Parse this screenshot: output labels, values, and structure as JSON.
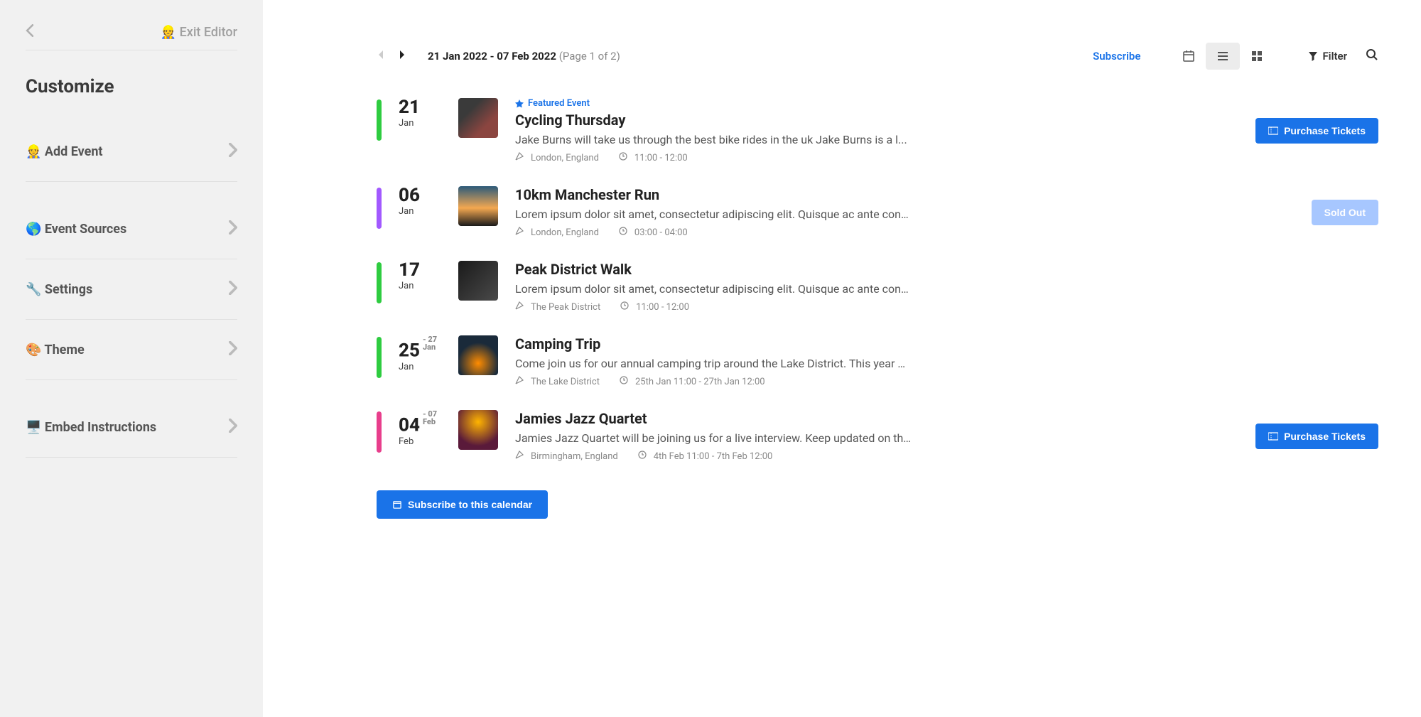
{
  "sidebar": {
    "exit_label": "👷 Exit Editor",
    "heading": "Customize",
    "items": [
      {
        "label": "👷 Add Event"
      },
      {
        "label": "🌎 Event Sources"
      },
      {
        "label": "🔧 Settings"
      },
      {
        "label": "🎨 Theme"
      },
      {
        "label": "🖥️ Embed Instructions"
      }
    ]
  },
  "toolbar": {
    "date_start": "21 Jan 2022",
    "date_end": "07 Feb 2022",
    "page_info": "(Page 1 of 2)",
    "subscribe_label": "Subscribe",
    "filter_label": "Filter"
  },
  "colors": {
    "green": "#2ecc40",
    "purple": "#a259ff",
    "pink": "#e83e8c",
    "primary": "#1a73e8",
    "soldout": "#a7c7ff"
  },
  "actions": {
    "purchase": "Purchase Tickets",
    "soldout": "Sold Out",
    "subscribe_bottom": "Subscribe to this calendar"
  },
  "events": [
    {
      "day": "21",
      "month": "Jan",
      "end_day": "",
      "end_month": "",
      "color": "green",
      "featured": true,
      "featured_label": "Featured Event",
      "title": "Cycling Thursday",
      "desc": "Jake Burns will take us through the best bike rides in the uk Jake Burns is a l...",
      "location": "London, England",
      "time": "11:00 - 12:00",
      "action": "purchase",
      "thumb": "cycling"
    },
    {
      "day": "06",
      "month": "Jan",
      "end_day": "",
      "end_month": "",
      "color": "purple",
      "featured": false,
      "title": "10km Manchester Run",
      "desc": "Lorem ipsum dolor sit amet, consectetur adipiscing elit. Quisque ac ante consect...",
      "location": "London, England",
      "time": "03:00 - 04:00",
      "action": "soldout",
      "thumb": "running"
    },
    {
      "day": "17",
      "month": "Jan",
      "end_day": "",
      "end_month": "",
      "color": "green",
      "featured": false,
      "title": "Peak District Walk",
      "desc": "Lorem ipsum dolor sit amet, consectetur adipiscing elit. Quisque ac ante consect...",
      "location": "The Peak District",
      "time": "11:00 - 12:00",
      "action": "",
      "thumb": "walk"
    },
    {
      "day": "25",
      "month": "Jan",
      "end_day": "27",
      "end_month": "Jan",
      "color": "green",
      "featured": false,
      "title": "Camping Trip",
      "desc": "Come join us for our annual camping trip around the Lake District. This year we...",
      "location": "The Lake District",
      "time": "25th Jan 11:00 - 27th Jan 12:00",
      "action": "",
      "thumb": "camping"
    },
    {
      "day": "04",
      "month": "Feb",
      "end_day": "07",
      "end_month": "Feb",
      "color": "pink",
      "featured": false,
      "title": "Jamies Jazz Quartet",
      "desc": "Jamies Jazz Quartet will be joining us for a live interview. Keep updated on the...",
      "location": "Birmingham, England",
      "time": "4th Feb 11:00 - 7th Feb 12:00",
      "action": "purchase",
      "thumb": "jazz"
    }
  ]
}
